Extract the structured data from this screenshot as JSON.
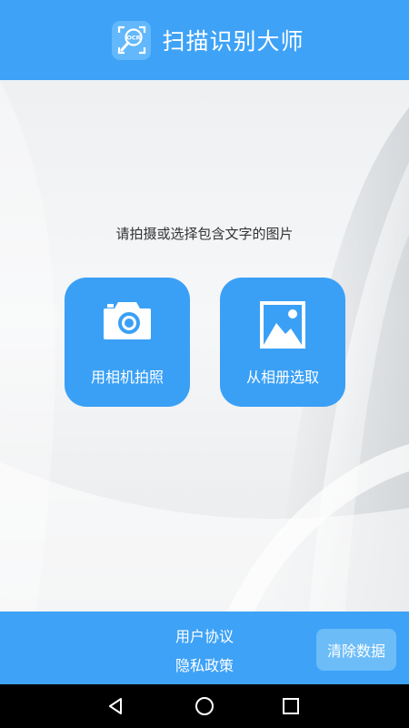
{
  "header": {
    "title": "扫描识别大师",
    "logo_icon": "ocr-magnifier-icon",
    "logo_text": "OCR",
    "color": "#3ea2f7"
  },
  "main": {
    "prompt": "请拍摄或选择包含文字的图片",
    "actions": [
      {
        "label": "用相机拍照",
        "icon": "camera-icon"
      },
      {
        "label": "从相册选取",
        "icon": "image-icon"
      }
    ],
    "button_color": "#3aa0f6"
  },
  "footer": {
    "links": [
      {
        "label": "用户协议"
      },
      {
        "label": "隐私政策"
      }
    ],
    "clear_button": "清除数据"
  },
  "navbar": {
    "icons": [
      "back-triangle-icon",
      "home-circle-icon",
      "recent-square-icon"
    ]
  }
}
